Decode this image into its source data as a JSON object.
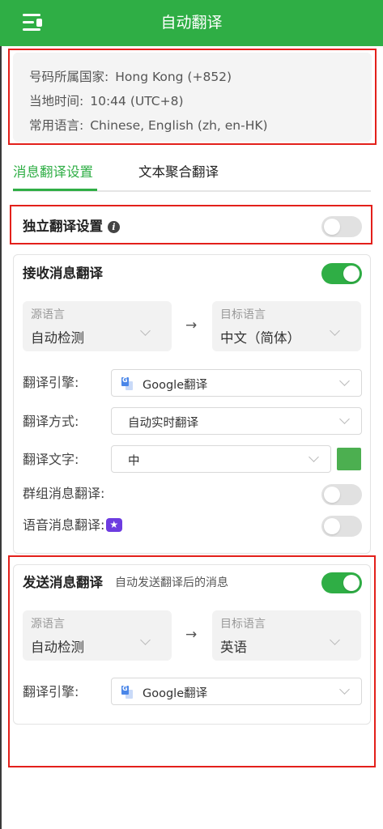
{
  "header": {
    "title": "自动翻译"
  },
  "info": {
    "country_label": "号码所属国家:",
    "country_value": "Hong Kong (+852)",
    "time_label": "当地时间:",
    "time_value": "10:44 (UTC+8)",
    "lang_label": "常用语言:",
    "lang_value": "Chinese, English (zh, en-HK)"
  },
  "tabs": [
    {
      "label": "消息翻译设置",
      "active": true
    },
    {
      "label": "文本聚合翻译",
      "active": false
    }
  ],
  "independent": {
    "title": "独立翻译设置",
    "enabled": false
  },
  "receive": {
    "title": "接收消息翻译",
    "enabled": true,
    "source_caption": "源语言",
    "source_value": "自动检测",
    "target_caption": "目标语言",
    "target_value": "中文（简体）",
    "arrow": "→",
    "engine_label": "翻译引擎:",
    "engine_value": "Google翻译",
    "mode_label": "翻译方式:",
    "mode_value": "自动实时翻译",
    "text_label": "翻译文字:",
    "text_value": "中",
    "text_color": "#4caf50",
    "group_label": "群组消息翻译:",
    "group_enabled": false,
    "voice_label": "语音消息翻译:",
    "voice_enabled": false
  },
  "send": {
    "title": "发送消息翻译",
    "subtitle": "自动发送翻译后的消息",
    "enabled": true,
    "source_caption": "源语言",
    "source_value": "自动检测",
    "target_caption": "目标语言",
    "target_value": "英语",
    "arrow": "→",
    "engine_label": "翻译引擎:",
    "engine_value": "Google翻译"
  },
  "colors": {
    "accent": "#2fae45",
    "highlight": "#e3201b"
  }
}
